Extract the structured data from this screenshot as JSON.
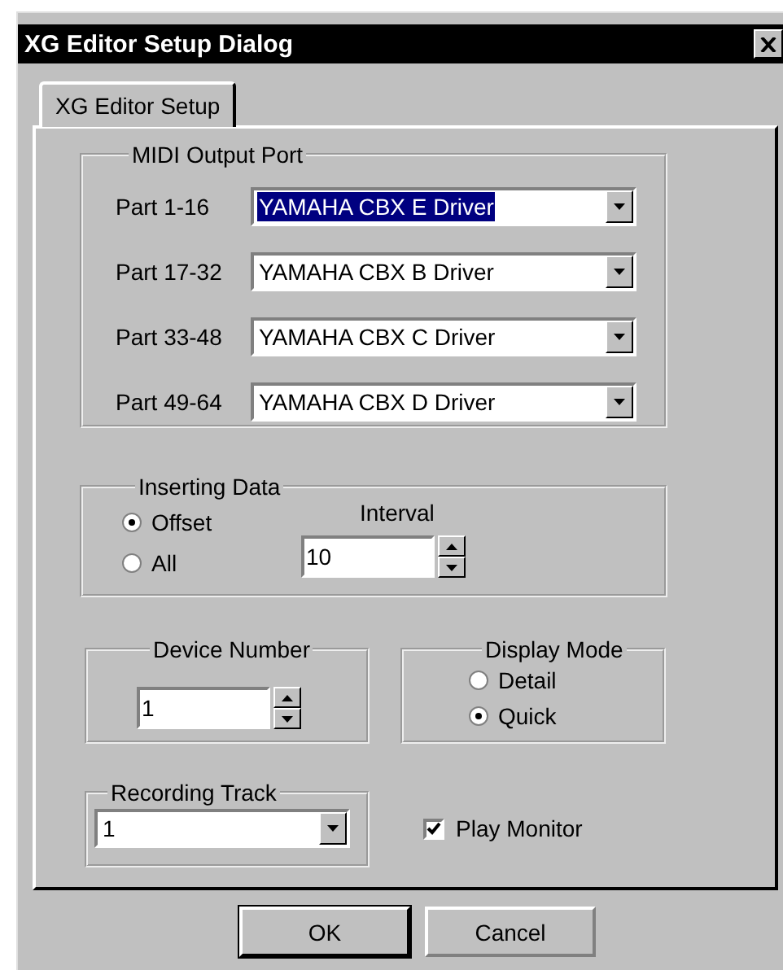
{
  "window": {
    "title": "XG Editor Setup Dialog"
  },
  "tabs": [
    {
      "label": "XG Editor Setup",
      "selected": true
    }
  ],
  "midi_output_port": {
    "title": "MIDI Output Port",
    "rows": [
      {
        "label": "Part  1-16",
        "value": "YAMAHA CBX E Driver",
        "focused": true
      },
      {
        "label": "Part 17-32",
        "value": "YAMAHA CBX B Driver",
        "focused": false
      },
      {
        "label": "Part 33-48",
        "value": "YAMAHA CBX C Driver",
        "focused": false
      },
      {
        "label": "Part 49-64",
        "value": "YAMAHA CBX D Driver",
        "focused": false
      }
    ]
  },
  "inserting_data": {
    "title": "Inserting Data",
    "options": [
      {
        "label": "Offset",
        "selected": true
      },
      {
        "label": "All",
        "selected": false
      }
    ],
    "interval": {
      "label": "Interval",
      "value": "10"
    }
  },
  "device_number": {
    "title": "Device Number",
    "value": "1"
  },
  "display_mode": {
    "title": "Display Mode",
    "options": [
      {
        "label": "Detail",
        "selected": false
      },
      {
        "label": "Quick",
        "selected": true
      }
    ]
  },
  "recording_track": {
    "title": "Recording Track",
    "value": "1"
  },
  "play_monitor": {
    "label": "Play Monitor",
    "checked": true
  },
  "buttons": [
    {
      "label": "OK",
      "default": true
    },
    {
      "label": "Cancel",
      "default": false
    }
  ]
}
